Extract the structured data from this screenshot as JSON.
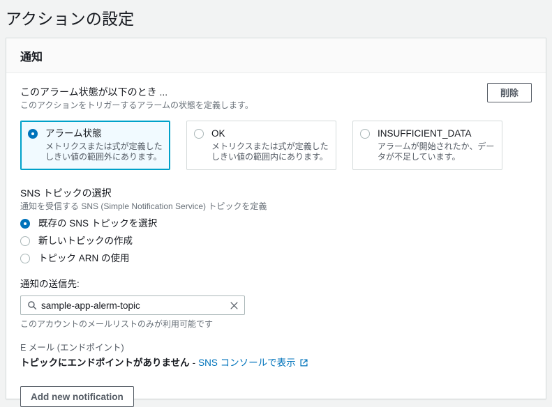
{
  "page": {
    "title": "アクションの設定"
  },
  "panel": {
    "header_title": "通知",
    "delete_label": "削除"
  },
  "alarm_state": {
    "heading": "このアラーム状態が以下のとき ...",
    "subtext": "このアクションをトリガーするアラームの状態を定義します。",
    "options": [
      {
        "label": "アラーム状態",
        "description": "メトリクスまたは式が定義したしきい値の範囲外にあります。",
        "selected": true
      },
      {
        "label": "OK",
        "description": "メトリクスまたは式が定義したしきい値の範囲内にあります。",
        "selected": false
      },
      {
        "label": "INSUFFICIENT_DATA",
        "description": "アラームが開始されたか、データが不足しています。",
        "selected": false
      }
    ]
  },
  "sns": {
    "heading": "SNS トピックの選択",
    "subtext": "通知を受信する SNS (Simple Notification Service) トピックを定義",
    "options": [
      {
        "label": "既存の SNS トピックを選択",
        "selected": true
      },
      {
        "label": "新しいトピックの作成",
        "selected": false
      },
      {
        "label": "トピック ARN の使用",
        "selected": false
      }
    ]
  },
  "destination": {
    "label": "通知の送信先:",
    "value": "sample-app-alerm-topic",
    "placeholder": "",
    "help_text": "このアカウントのメールリストのみが利用可能です",
    "search_icon": "search-icon",
    "clear_icon": "close-icon"
  },
  "endpoint": {
    "label": "E メール (エンドポイント)",
    "message": "トピックにエンドポイントがありません",
    "separator": "-",
    "link_label": "SNS コンソールで表示",
    "link_icon": "external-link-icon"
  },
  "footer": {
    "add_label": "Add new notification"
  },
  "colors": {
    "page_background": "#f2f3f3",
    "panel_background": "#ffffff",
    "panel_header_background": "#fafafa",
    "accent_blue": "#0073bb",
    "selected_card_border": "#00a1c9",
    "selected_card_background": "#f1faff",
    "border_gray": "#d5dbdb",
    "text_primary": "#16191f",
    "text_secondary": "#687078",
    "button_border": "#545b64"
  }
}
